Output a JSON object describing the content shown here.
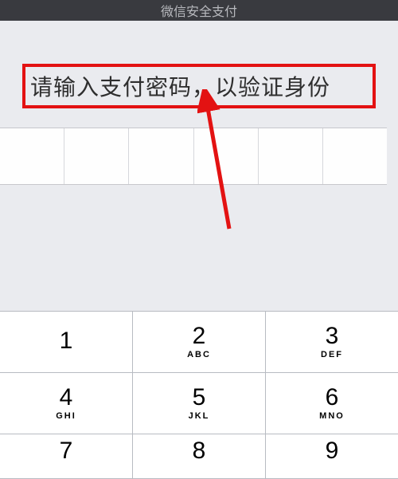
{
  "header": {
    "title": "微信安全支付"
  },
  "prompt": {
    "text": "请输入支付密码，以验证身份"
  },
  "annotation": {
    "color": "#e31212"
  },
  "pin": {
    "length": 6
  },
  "keypad": {
    "rows": [
      [
        {
          "num": "1",
          "sub": ""
        },
        {
          "num": "2",
          "sub": "ABC"
        },
        {
          "num": "3",
          "sub": "DEF"
        }
      ],
      [
        {
          "num": "4",
          "sub": "GHI"
        },
        {
          "num": "5",
          "sub": "JKL"
        },
        {
          "num": "6",
          "sub": "MNO"
        }
      ],
      [
        {
          "num": "7",
          "sub": ""
        },
        {
          "num": "8",
          "sub": ""
        },
        {
          "num": "9",
          "sub": ""
        }
      ]
    ]
  }
}
